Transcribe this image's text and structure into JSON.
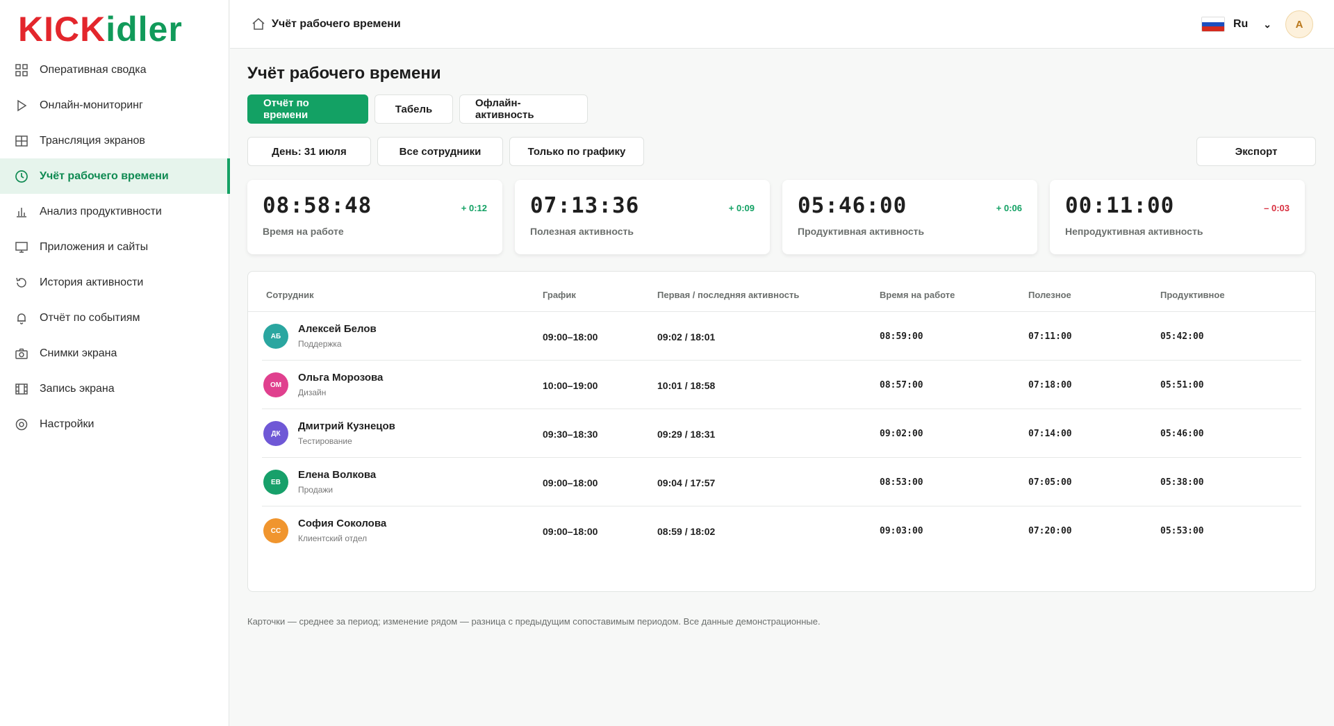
{
  "logo": {
    "part1": "KICK",
    "part2": "idler"
  },
  "sidebar": {
    "items": [
      {
        "label": "Оперативная сводка",
        "icon": "grid-icon"
      },
      {
        "label": "Онлайн-мониторинг",
        "icon": "play-icon"
      },
      {
        "label": "Трансляция экранов",
        "icon": "screens-icon"
      },
      {
        "label": "Учёт рабочего времени",
        "icon": "clock-icon",
        "active": true
      },
      {
        "label": "Анализ продуктивности",
        "icon": "bar-chart-icon"
      },
      {
        "label": "Приложения и сайты",
        "icon": "monitor-icon"
      },
      {
        "label": "История активности",
        "icon": "history-icon"
      },
      {
        "label": "Отчёт по событиям",
        "icon": "bell-icon"
      },
      {
        "label": "Снимки экрана",
        "icon": "camera-icon"
      },
      {
        "label": "Запись экрана",
        "icon": "film-icon"
      },
      {
        "label": "Настройки",
        "icon": "settings-icon"
      }
    ]
  },
  "topbar": {
    "breadcrumb": "Учёт рабочего времени",
    "language": "Ru",
    "avatar": "A"
  },
  "page": {
    "title": "Учёт рабочего времени",
    "tabs": [
      "Отчёт по времени",
      "Табель",
      "Офлайн-активность"
    ],
    "filters": [
      "День: 31 июля",
      "Все сотрудники",
      "Только по графику"
    ],
    "export": "Экспорт"
  },
  "cards": [
    {
      "value": "08:58:48",
      "delta": "+ 0:12",
      "trend": "up",
      "label": "Время на работе"
    },
    {
      "value": "07:13:36",
      "delta": "+ 0:09",
      "trend": "up",
      "label": "Полезная активность"
    },
    {
      "value": "05:46:00",
      "delta": "+ 0:06",
      "trend": "up",
      "label": "Продуктивная активность"
    },
    {
      "value": "00:11:00",
      "delta": "– 0:03",
      "trend": "down",
      "label": "Непродуктивная активность"
    }
  ],
  "table": {
    "headers": [
      "Сотрудник",
      "График",
      "Первая / последняя активность",
      "Время на работе",
      "Полезное",
      "Продуктивное"
    ],
    "rows": [
      {
        "initials": "АБ",
        "color": "#2aa6a0",
        "name": "Алексей Белов",
        "dept": "Поддержка",
        "schedule": "09:00–18:00",
        "activity": "09:02 / 18:01",
        "work": "08:59:00",
        "useful": "07:11:00",
        "productive": "05:42:00"
      },
      {
        "initials": "ОМ",
        "color": "#e0408e",
        "name": "Ольга Морозова",
        "dept": "Дизайн",
        "schedule": "10:00–19:00",
        "activity": "10:01 / 18:58",
        "work": "08:57:00",
        "useful": "07:18:00",
        "productive": "05:51:00"
      },
      {
        "initials": "ДК",
        "color": "#6f58d6",
        "name": "Дмитрий Кузнецов",
        "dept": "Тестирование",
        "schedule": "09:30–18:30",
        "activity": "09:29 / 18:31",
        "work": "09:02:00",
        "useful": "07:14:00",
        "productive": "05:46:00"
      },
      {
        "initials": "ЕВ",
        "color": "#17a06a",
        "name": "Елена Волкова",
        "dept": "Продажи",
        "schedule": "09:00–18:00",
        "activity": "09:04 / 17:57",
        "work": "08:53:00",
        "useful": "07:05:00",
        "productive": "05:38:00"
      },
      {
        "initials": "СС",
        "color": "#f0952e",
        "name": "София Соколова",
        "dept": "Клиентский отдел",
        "schedule": "09:00–18:00",
        "activity": "08:59 / 18:02",
        "work": "09:03:00",
        "useful": "07:20:00",
        "productive": "05:53:00"
      }
    ]
  },
  "footnote": "Карточки — среднее за период; изменение рядом — разница с предыдущим сопоставимым периодом. Все данные демонстрационные."
}
